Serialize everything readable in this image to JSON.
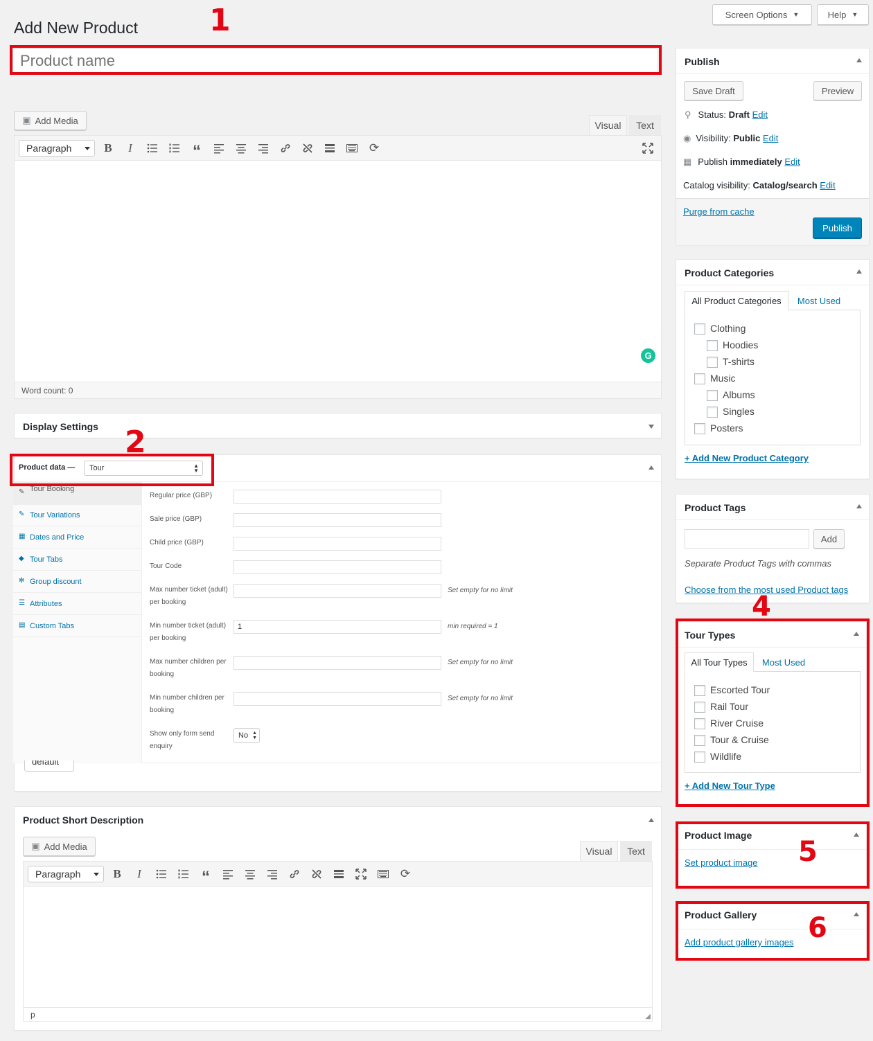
{
  "header": {
    "page_title": "Add New Product",
    "screen_options": "Screen Options",
    "help": "Help"
  },
  "title_field": {
    "placeholder": "Product name",
    "value": ""
  },
  "editor": {
    "add_media": "Add Media",
    "tab_visual": "Visual",
    "tab_text": "Text",
    "format": "Paragraph",
    "word_count": "Word count: 0"
  },
  "display_settings": {
    "title": "Display Settings"
  },
  "product_data": {
    "label": "Product data —",
    "type": "Tour",
    "tabs": [
      {
        "label": "Tour Booking",
        "icon": "wrench-icon"
      },
      {
        "label": "Tour Variations",
        "icon": "variations-icon"
      },
      {
        "label": "Dates and Price",
        "icon": "calendar-icon"
      },
      {
        "label": "Tour Tabs",
        "icon": "tag-icon"
      },
      {
        "label": "Group discount",
        "icon": "group-icon"
      },
      {
        "label": "Attributes",
        "icon": "list-icon"
      },
      {
        "label": "Custom Tabs",
        "icon": "table-icon"
      }
    ],
    "fields": [
      {
        "label": "Regular price (GBP)",
        "value": "",
        "hint": ""
      },
      {
        "label": "Sale price (GBP)",
        "value": "",
        "hint": ""
      },
      {
        "label": "Child price (GBP)",
        "value": "",
        "hint": ""
      },
      {
        "label": "Tour Code",
        "value": "",
        "hint": ""
      },
      {
        "label": "Max number ticket (adult) per booking",
        "value": "",
        "hint": "Set empty for no limit"
      },
      {
        "label": "Min number ticket (adult) per booking",
        "value": "1",
        "hint": "min required = 1"
      },
      {
        "label": "Max number children per booking",
        "value": "",
        "hint": "Set empty for no limit"
      },
      {
        "label": "Min number children per booking",
        "value": "",
        "hint": "Set empty for no limit"
      }
    ],
    "form_enquiry": {
      "label": "Show only form send enquiry",
      "value": "No"
    },
    "behind_select": "default"
  },
  "short_desc": {
    "title": "Product Short Description",
    "add_media": "Add Media",
    "tab_visual": "Visual",
    "tab_text": "Text",
    "format": "Paragraph",
    "path": "p"
  },
  "publish": {
    "title": "Publish",
    "save_draft": "Save Draft",
    "preview": "Preview",
    "status_label": "Status:",
    "status_value": "Draft",
    "visibility_label": "Visibility:",
    "visibility_value": "Public",
    "publish_label": "Publish",
    "publish_value": "immediately",
    "catalog_label": "Catalog visibility:",
    "catalog_value": "Catalog/search",
    "edit": "Edit",
    "purge": "Purge from cache",
    "publish_button": "Publish"
  },
  "categories": {
    "title": "Product Categories",
    "tab_all": "All Product Categories",
    "tab_most": "Most Used",
    "items": [
      "Clothing",
      "Hoodies",
      "T-shirts",
      "Music",
      "Albums",
      "Singles",
      "Posters"
    ],
    "add_new": "+ Add New Product Category"
  },
  "tags": {
    "title": "Product Tags",
    "add": "Add",
    "hint": "Separate Product Tags with commas",
    "choose": "Choose from the most used Product tags"
  },
  "tour_types": {
    "title": "Tour Types",
    "tab_all": "All Tour Types",
    "tab_most": "Most Used",
    "items": [
      "Escorted Tour",
      "Rail Tour",
      "River Cruise",
      "Tour & Cruise",
      "Wildlife"
    ],
    "add_new": "+ Add New Tour Type"
  },
  "product_image": {
    "title": "Product Image",
    "link": "Set product image"
  },
  "product_gallery": {
    "title": "Product Gallery",
    "link": "Add product gallery images"
  },
  "annotations": [
    "1",
    "2",
    "4",
    "5",
    "6"
  ],
  "colors": {
    "annotation_red": "#e30613",
    "link": "#0073aa",
    "primary": "#0085ba",
    "grammarly": "#15c39a"
  }
}
